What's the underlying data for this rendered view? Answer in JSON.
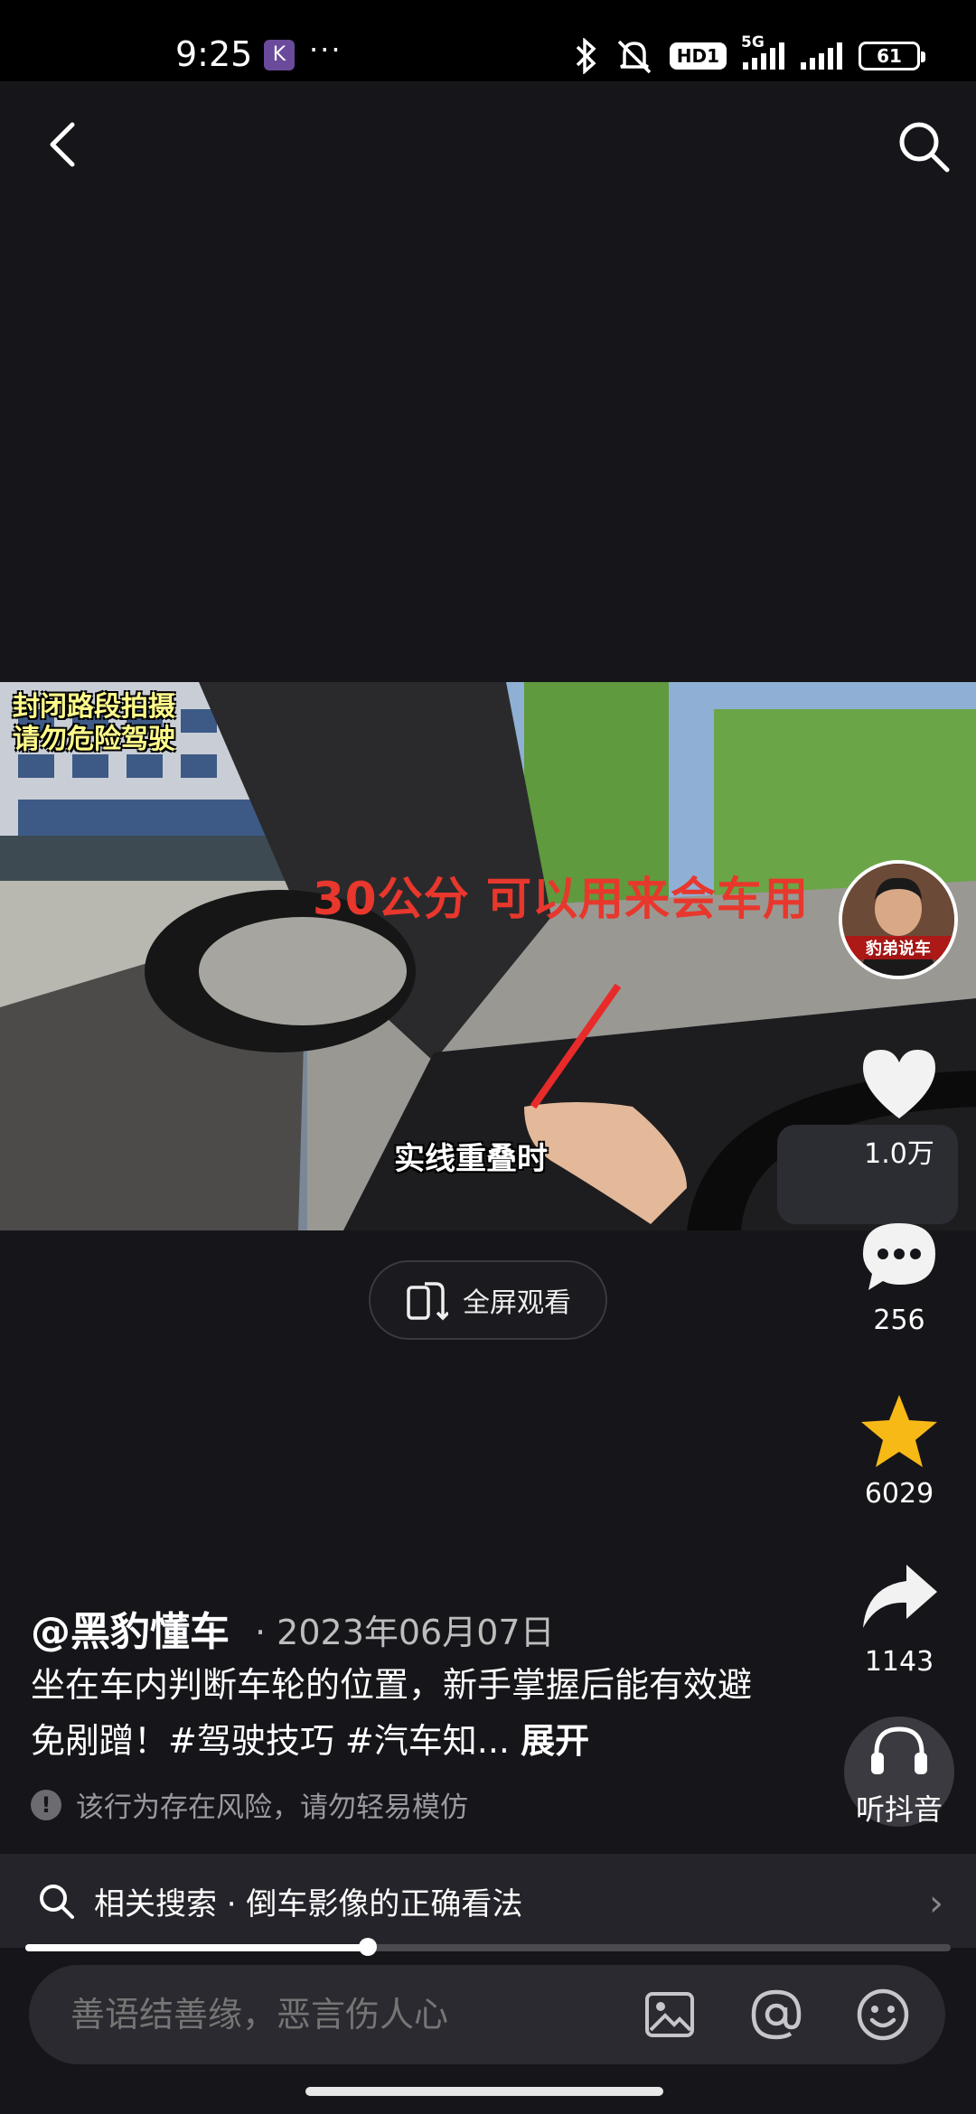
{
  "status_bar": {
    "time": "9:25",
    "app_badge": "K",
    "more": "···",
    "network_hd": "HD1",
    "network_5g": "5G",
    "battery": "61"
  },
  "video": {
    "overlay_notice_line1": "封闭路段拍摄",
    "overlay_notice_line2": "请勿危险驾驶",
    "headline": "30公分 可以用来会车用",
    "caption": "实线重叠时",
    "avatar_label": "豹弟说车"
  },
  "fullscreen_label": "全屏观看",
  "rail": {
    "likes": "1.0万",
    "comments": "256",
    "favorites": "6029",
    "shares": "1143",
    "listen_label": "听抖音"
  },
  "post": {
    "author": "@黑豹懂车",
    "date": "· 2023年06月07日",
    "description": "坐在车内判断车轮的位置，新手掌握后能有效避免剐蹭！#驾驶技巧 #汽车知...",
    "expand": "展开",
    "warning": "该行为存在风险，请勿轻易模仿"
  },
  "related_search": {
    "text": "相关搜索 · 倒车影像的正确看法"
  },
  "playback_progress": 0.37,
  "comment_bar": {
    "placeholder": "善语结善缘，恶言伤人心"
  },
  "colors": {
    "background": "#161519",
    "favorite_star": "#f7b916",
    "headline_red": "#e8372c"
  }
}
